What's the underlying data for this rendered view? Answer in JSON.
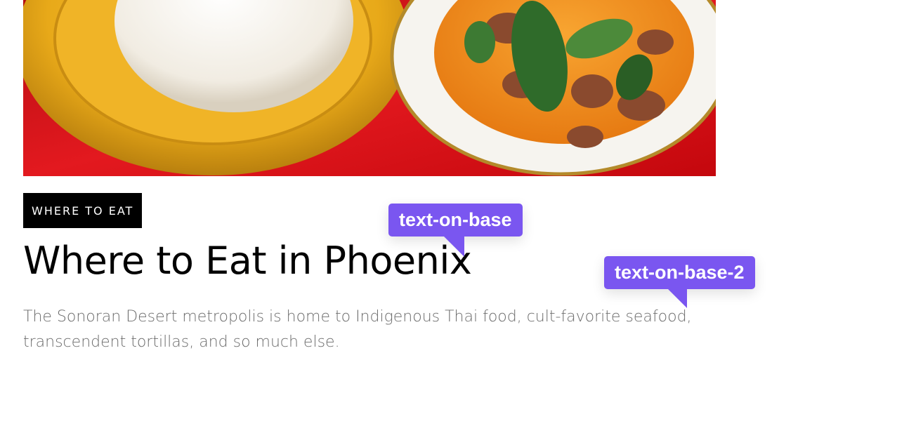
{
  "hero": {
    "description_icon": "food-photo"
  },
  "article": {
    "tag": "WHERE TO EAT",
    "title": "Where to Eat in Phoenix",
    "dek": "The Sonoran Desert metropolis is home to Indigenous Thai food, cult-favorite seafood, transcendent tortillas, and so much else."
  },
  "tokens": [
    {
      "label": "text-on-base"
    },
    {
      "label": "text-on-base-2"
    }
  ],
  "colors": {
    "tag_bg": "#000000",
    "title": "#000000",
    "dek": "#6c6c6c",
    "token_bg": "#7a56f0",
    "tablecloth": "#d8141a"
  }
}
